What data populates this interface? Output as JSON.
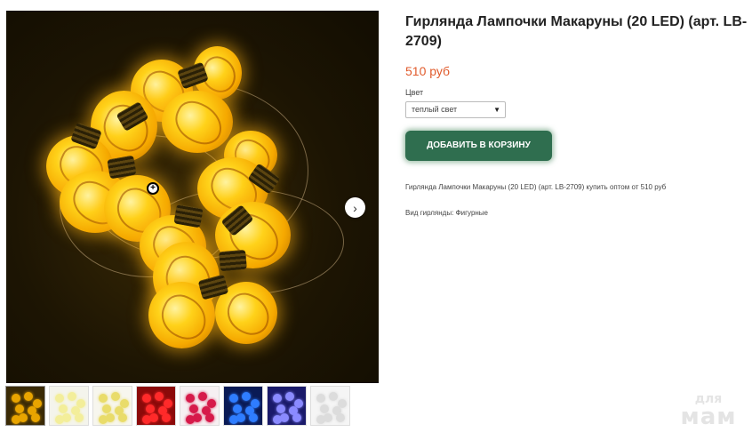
{
  "product": {
    "title": "Гирлянда Лампочки Макаруны (20 LED) (арт. LB-2709)",
    "price": "510 руб",
    "option_label": "Цвет",
    "option_value": "теплый свет",
    "add_to_cart_label": "ДОБАВИТЬ В КОРЗИНУ",
    "description": "Гирлянда Лампочки Макаруны (20 LED) (арт. LB-2709) купить оптом от 510 руб",
    "kind_label": "Вид гирлянды:",
    "kind_value": "Фигурные"
  },
  "gallery": {
    "main_image": "yellow-bulb-garland-photo",
    "next_icon": "chevron-right-icon",
    "zoom_icon": "zoom-in-icon",
    "thumbnails": [
      {
        "name": "thumb-warm",
        "color": "#e8a400",
        "bg": "#3a2a06"
      },
      {
        "name": "thumb-white-warm",
        "color": "#f3ee9a",
        "bg": "#f4f4ec"
      },
      {
        "name": "thumb-white-yellow",
        "color": "#e9dc6a",
        "bg": "#f7f6ee"
      },
      {
        "name": "thumb-red",
        "color": "#ff2a2a",
        "bg": "#8c0a0a"
      },
      {
        "name": "thumb-pink",
        "color": "#d61a4a",
        "bg": "#f6f0f2"
      },
      {
        "name": "thumb-blue",
        "color": "#2f7dff",
        "bg": "#0a1a55"
      },
      {
        "name": "thumb-violet",
        "color": "#8a8aff",
        "bg": "#1a1a6a"
      },
      {
        "name": "thumb-white",
        "color": "#dcdcdc",
        "bg": "#f5f5f5"
      }
    ]
  },
  "watermark": {
    "top": "для",
    "bottom": "мам"
  },
  "colors": {
    "price": "#e05a2b",
    "button": "#2f6e4f"
  }
}
